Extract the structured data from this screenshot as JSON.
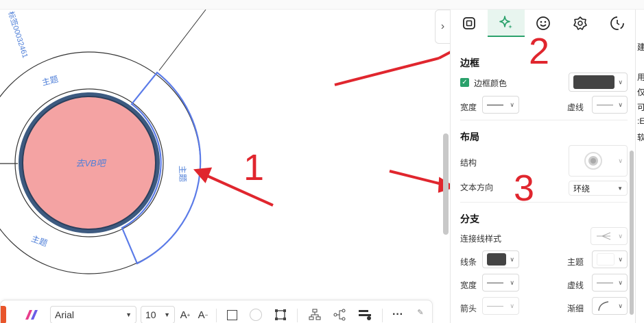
{
  "canvas": {
    "center_topic": "去VB吧",
    "subtopics": [
      "主题",
      "主题",
      "主题"
    ],
    "rotated_text": "标签00032461"
  },
  "bottom_toolbar": {
    "font_family": "Arial",
    "font_size": "10",
    "increase_font": "A",
    "decrease_font": "A",
    "more": "···"
  },
  "panel": {
    "tabs": [
      {
        "icon": "frame-icon",
        "active": false
      },
      {
        "icon": "sparkle-icon",
        "active": true
      },
      {
        "icon": "smiley-icon",
        "active": false
      },
      {
        "icon": "badge-icon",
        "active": false
      },
      {
        "icon": "clock-icon",
        "active": false
      }
    ],
    "border_section": {
      "title": "边框",
      "border_color_label": "边框颜色",
      "border_color": "#444444",
      "width_label": "宽度",
      "dash_label": "虚线"
    },
    "layout_section": {
      "title": "布局",
      "structure_label": "结构",
      "text_direction_label": "文本方向",
      "text_direction_value": "环绕"
    },
    "branch_section": {
      "title": "分支",
      "connector_style_label": "连接线样式",
      "line_label": "线条",
      "line_color": "#444444",
      "topic_label": "主题",
      "width_label": "宽度",
      "dash_label": "虚线",
      "arrow_label": "箭头",
      "taper_label": "渐细"
    }
  },
  "side_strip": {
    "chars": [
      "建",
      "用",
      "仅",
      "可",
      ":E",
      "软"
    ]
  },
  "annotations": {
    "labels": [
      "1",
      "2",
      "3"
    ],
    "color": "#e0262e"
  },
  "colors": {
    "accent_green": "#2aa16b",
    "topic_fill": "#f4a3a3",
    "topic_ring": "#3d5a80",
    "selection_blue": "#5b7be8",
    "subtopic_text": "#4f7fd8"
  }
}
